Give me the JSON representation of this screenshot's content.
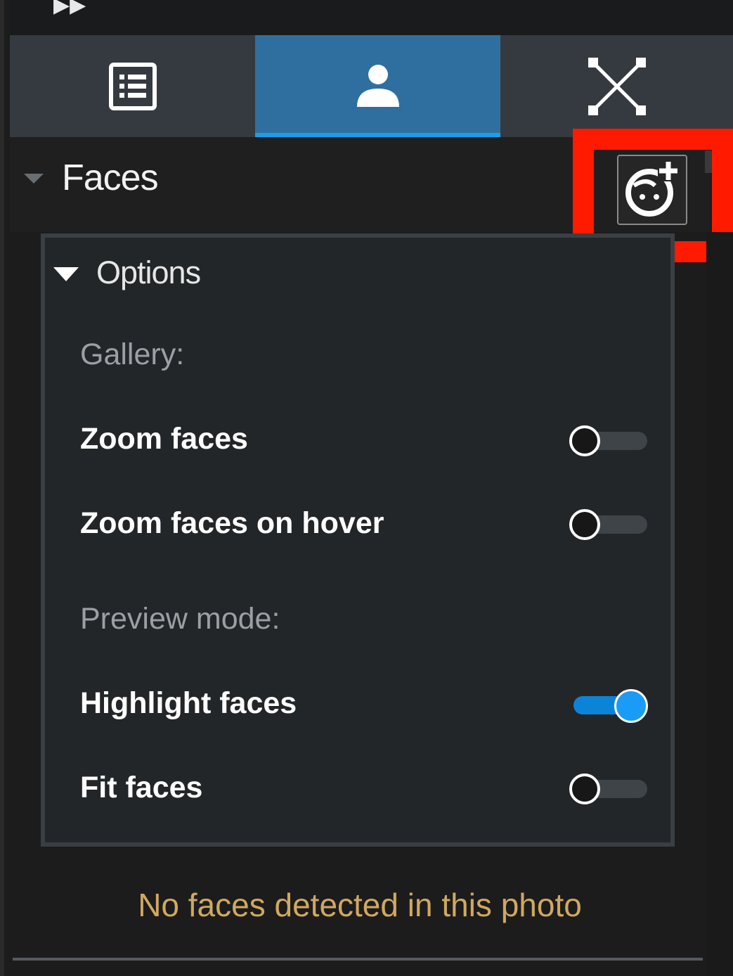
{
  "tabs": [
    {
      "icon": "list-icon",
      "active": false
    },
    {
      "icon": "person-icon",
      "active": true
    },
    {
      "icon": "network-graph-icon",
      "active": false
    }
  ],
  "faces_section": {
    "title": "Faces",
    "add_face_icon": "add-face-icon"
  },
  "options": {
    "title": "Options",
    "gallery_label": "Gallery:",
    "preview_mode_label": "Preview mode:",
    "toggles": [
      {
        "label": "Zoom faces",
        "on": false
      },
      {
        "label": "Zoom faces on hover",
        "on": false
      },
      {
        "label": "Highlight faces",
        "on": true
      },
      {
        "label": "Fit faces",
        "on": false
      }
    ]
  },
  "status": {
    "message": "No faces detected in this photo"
  },
  "colors": {
    "accent": "#1e9dea",
    "active_tab": "#2f6f9f",
    "highlight_box": "#ff1a00",
    "status_text": "#d0a860"
  }
}
